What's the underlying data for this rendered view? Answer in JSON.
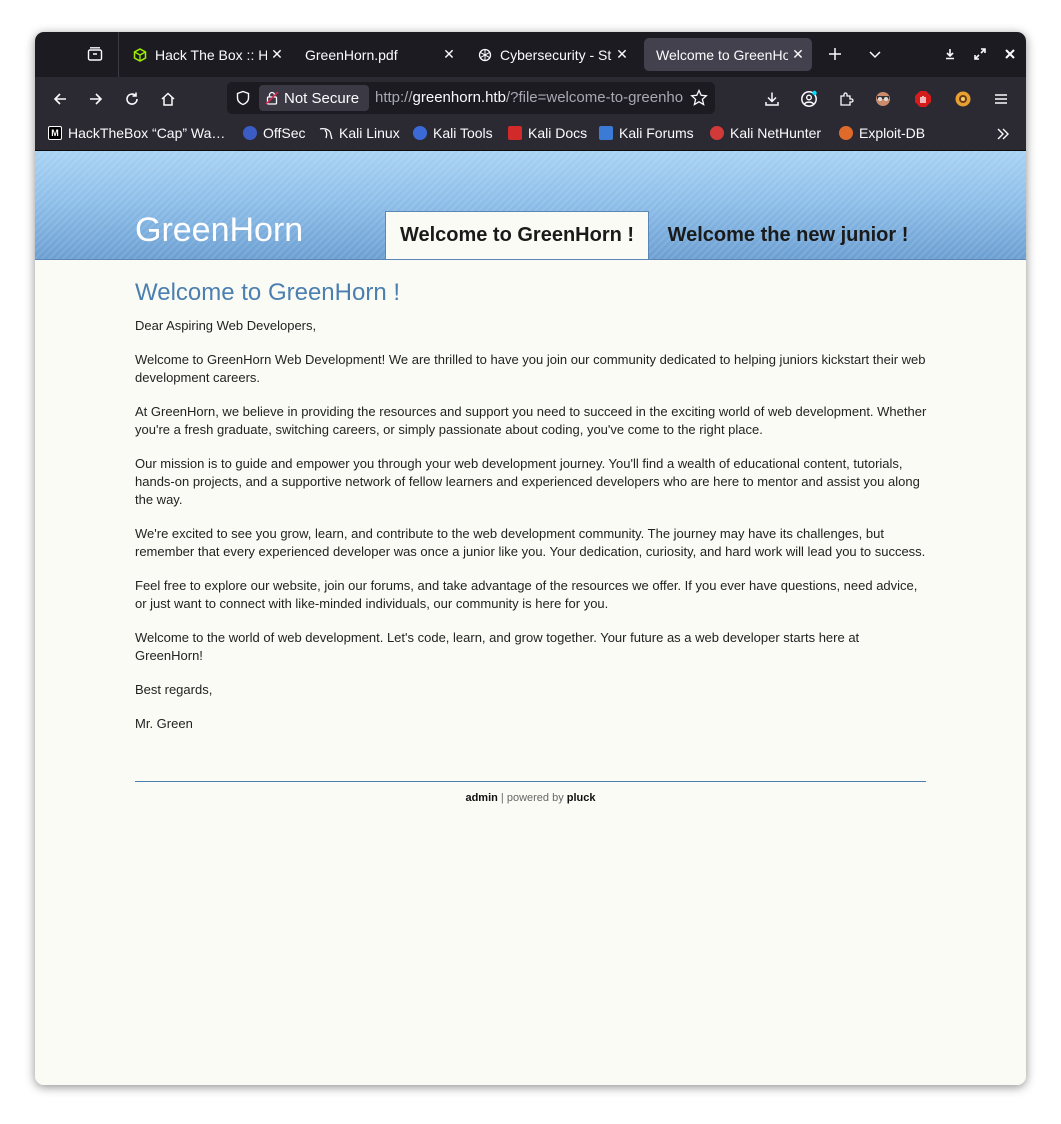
{
  "browser": {
    "tabs": [
      {
        "label": "Hack The Box :: Hack The Box",
        "icon": "htb-cube-icon"
      },
      {
        "label": "GreenHorn.pdf",
        "icon": ""
      },
      {
        "label": "Cybersecurity - Study",
        "icon": "openai-icon"
      },
      {
        "label": "Welcome to GreenHorn",
        "icon": ""
      }
    ],
    "address": {
      "security_label": "Not Secure",
      "url_scheme": "http://",
      "url_host": "greenhorn.htb",
      "url_path": "/?file=welcome-to-greenhorn"
    },
    "bookmarks": [
      {
        "label": "HackTheBox “Cap” Wa…",
        "color": "#000000"
      },
      {
        "label": "OffSec",
        "color": "#3b5cc4"
      },
      {
        "label": "Kali Linux",
        "color": "#2b2a33"
      },
      {
        "label": "Kali Tools",
        "color": "#3b6ad6"
      },
      {
        "label": "Kali Docs",
        "color": "#d22a2a"
      },
      {
        "label": "Kali Forums",
        "color": "#3b7bd6"
      },
      {
        "label": "Kali NetHunter",
        "color": "#d23a3a"
      },
      {
        "label": "Exploit-DB",
        "color": "#e06a2a"
      }
    ]
  },
  "site": {
    "title": "GreenHorn",
    "nav": [
      {
        "label": "Welcome to GreenHorn !",
        "active": true
      },
      {
        "label": "Welcome the new junior !",
        "active": false
      }
    ],
    "heading": "Welcome to GreenHorn !",
    "paragraphs": [
      "Dear Aspiring Web Developers,",
      "Welcome to GreenHorn Web Development! We are thrilled to have you join our community dedicated to helping juniors kickstart their web development careers.",
      "At GreenHorn, we believe in providing the resources and support you need to succeed in the exciting world of web development. Whether you're a fresh graduate, switching careers, or simply passionate about coding, you've come to the right place.",
      "Our mission is to guide and empower you through your web development journey. You'll find a wealth of educational content, tutorials, hands-on projects, and a supportive network of fellow learners and experienced developers who are here to mentor and assist you along the way.",
      "We're excited to see you grow, learn, and contribute to the web development community. The journey may have its challenges, but remember that every experienced developer was once a junior like you. Your dedication, curiosity, and hard work will lead you to success.",
      "Feel free to explore our website, join our forums, and take advantage of the resources we offer. If you ever have questions, need advice, or just want to connect with like-minded individuals, our community is here for you.",
      "Welcome to the world of web development. Let's code, learn, and grow together. Your future as a web developer starts here at GreenHorn!",
      "Best regards,",
      "Mr. Green"
    ],
    "footer": {
      "admin_label": "admin",
      "separator": " | powered by ",
      "pluck_label": "pluck"
    }
  },
  "colors": {
    "heading": "#4a7fb0",
    "header_top": "#a8d2f3",
    "header_bottom": "#6c9fd2"
  }
}
